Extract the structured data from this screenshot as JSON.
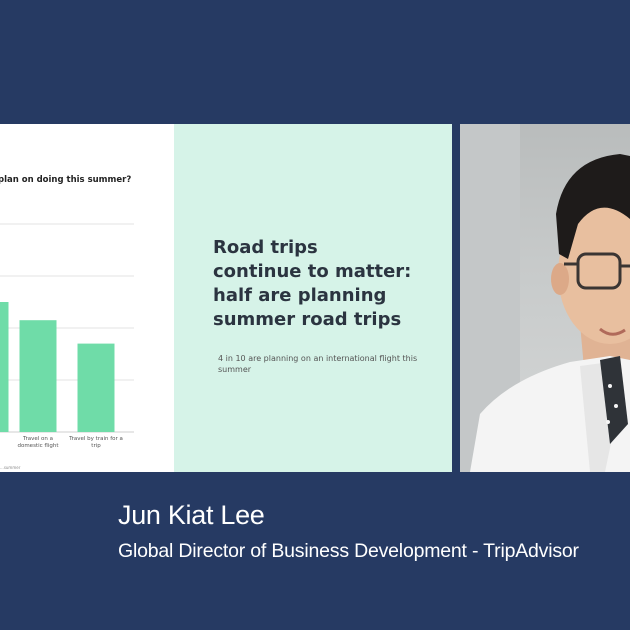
{
  "slide": {
    "question": "plan on doing this summer?",
    "headline_lines": [
      "Road trips",
      "continue to matter:",
      "half are planning",
      "summer road trips"
    ],
    "subtext": "4 in 10 are planning on an international flight this summer",
    "footnote": "...summer",
    "colors": {
      "bar": "#6fdca8",
      "panel_bg": "#d6f3e8",
      "grid": "#e3e3e3"
    }
  },
  "chart_data": {
    "type": "bar",
    "categories": [
      "...e",
      "Travel on a domestic flight",
      "Travel by train for a trip"
    ],
    "category_lines": [
      [
        "e"
      ],
      [
        "Travel on a",
        "domestic flight"
      ],
      [
        "Travel by train for a",
        "trip"
      ]
    ],
    "values": [
      50,
      43,
      34
    ],
    "ylim": [
      0,
      80
    ],
    "grid": true,
    "title": "plan on doing this summer?"
  },
  "speaker": {
    "name": "Jun Kiat Lee",
    "title": "Global Director of Business Development - TripAdvisor"
  },
  "colors": {
    "background": "#263a63",
    "text": "#ffffff"
  }
}
